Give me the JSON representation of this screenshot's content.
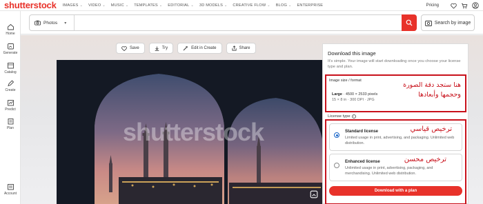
{
  "brand": {
    "logo": "shutterstock",
    "accent": "#e8322a",
    "annotation_red": "#c8101a"
  },
  "nav": {
    "links": [
      "IMAGES",
      "VIDEO",
      "MUSIC",
      "TEMPLATES",
      "EDITORIAL",
      "3D MODELS",
      "CREATIVE FLOW",
      "BLOG",
      "ENTERPRISE"
    ],
    "pricing": "Pricing"
  },
  "sidebar": {
    "items": [
      {
        "label": "Home",
        "icon": "home-icon"
      },
      {
        "label": "Generate",
        "icon": "generate-icon"
      },
      {
        "label": "Catalog",
        "icon": "catalog-icon"
      },
      {
        "label": "Create",
        "icon": "create-icon"
      },
      {
        "label": "Predict",
        "icon": "predict-icon"
      },
      {
        "label": "Plan",
        "icon": "plan-icon"
      },
      {
        "label": "Account",
        "icon": "account-icon"
      }
    ]
  },
  "search": {
    "type": "Photos",
    "value": "",
    "placeholder": "",
    "search_by_image": "Search by image"
  },
  "actions": {
    "save": "Save",
    "try": "Try",
    "edit": "Edit in Create",
    "share": "Share"
  },
  "photo": {
    "watermark": "shutterstock"
  },
  "panel": {
    "title": "Download this image",
    "subtitle": "It's simple. Your image will start downloading once you choose your license type and plan.",
    "size_label": "Image size / format",
    "size_name": "Large",
    "size_dims": "4500 × 2533 pixels",
    "size_detail": "15 × 8 in · 300 DPI · JPG",
    "license_label": "License type",
    "standard_title": "Standard license",
    "standard_desc": "Limited usage in print, advertising, and packaging. Unlimited web distribution.",
    "enhanced_title": "Enhanced license",
    "enhanced_desc": "Unlimited usage in print, advertising, packaging, and merchandising. Unlimited web distribution.",
    "download": "Download with a plan"
  },
  "annotations": {
    "size_line1": "هنا ستجد دقة الصورة",
    "size_line2": "وحجمها وأبعادها",
    "standard": "ترخيص قياسي",
    "enhanced": "ترخيص محسن"
  }
}
